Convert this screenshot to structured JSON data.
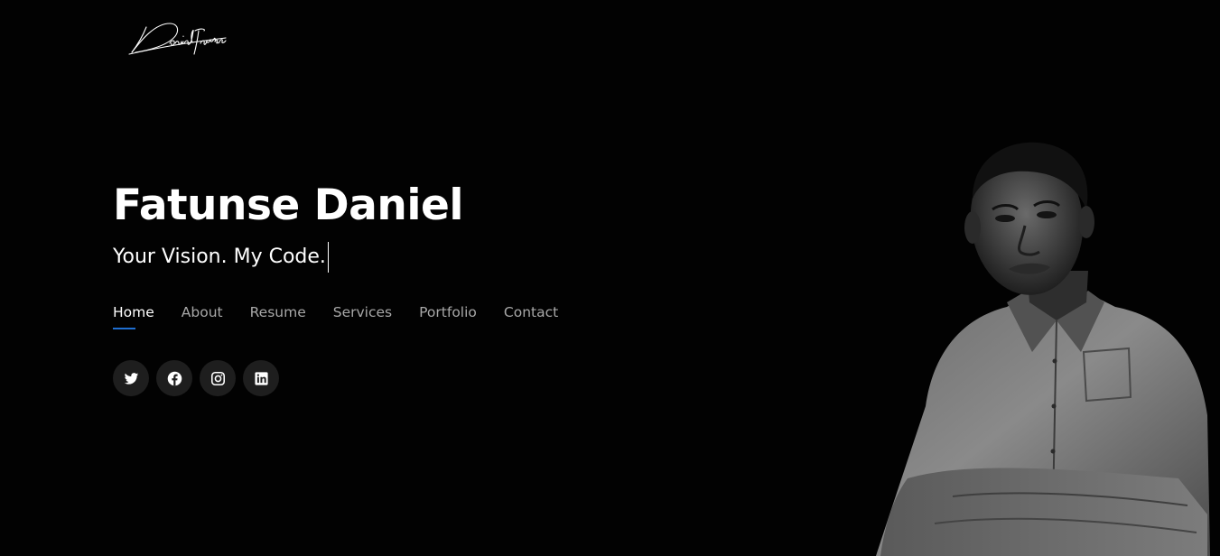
{
  "logo": {
    "text": "Daniel Fatunse",
    "style": "handwritten signature"
  },
  "hero": {
    "name": "Fatunse Daniel",
    "tagline": "Your Vision. My Code."
  },
  "nav": {
    "items": [
      {
        "label": "Home",
        "active": true
      },
      {
        "label": "About",
        "active": false
      },
      {
        "label": "Resume",
        "active": false
      },
      {
        "label": "Services",
        "active": false
      },
      {
        "label": "Portfolio",
        "active": false
      },
      {
        "label": "Contact",
        "active": false
      }
    ]
  },
  "socials": {
    "items": [
      {
        "name": "twitter",
        "icon": "twitter-icon"
      },
      {
        "name": "facebook",
        "icon": "facebook-icon"
      },
      {
        "name": "instagram",
        "icon": "instagram-icon"
      },
      {
        "name": "linkedin",
        "icon": "linkedin-icon"
      }
    ]
  },
  "portrait": {
    "image": "black-and-white portrait photo"
  },
  "colors": {
    "background": "#020202",
    "text_primary": "#ffffff",
    "text_muted": "#a8a8a8",
    "accent": "#1f6fd1",
    "social_bg": "#1e1e1e"
  }
}
